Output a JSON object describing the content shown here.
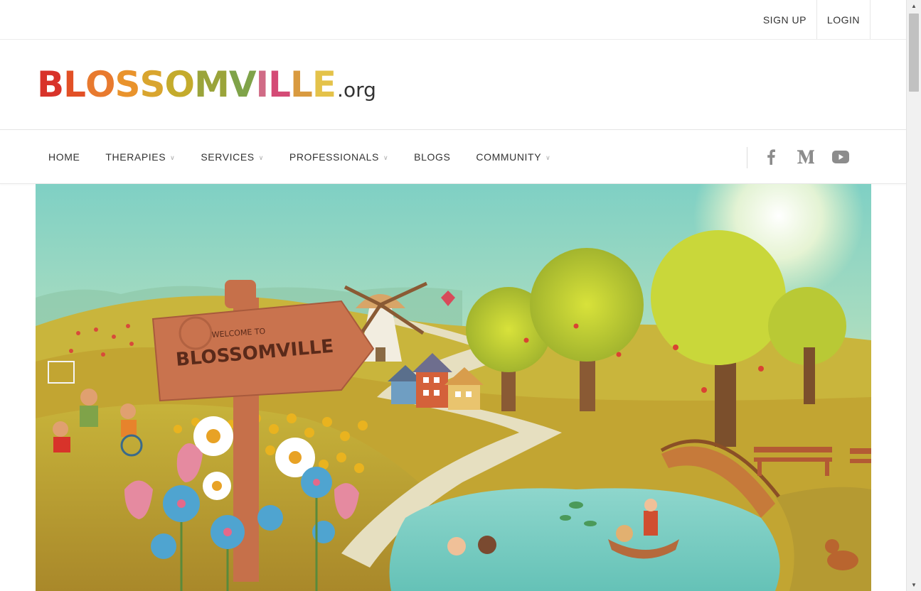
{
  "top_links": {
    "signup": "SIGN UP",
    "login": "LOGIN"
  },
  "logo": {
    "letters": [
      "B",
      "L",
      "O",
      "S",
      "S",
      "O",
      "M",
      "V",
      "I",
      "L",
      "L",
      "E"
    ],
    "colors": [
      "#d8332a",
      "#e25026",
      "#e87a2f",
      "#e9932c",
      "#d9a52e",
      "#c4ab2c",
      "#9aa43a",
      "#7fa349",
      "#d06b86",
      "#d44b76",
      "#d99a3f",
      "#e4c24a"
    ],
    "suffix": ".org"
  },
  "nav": {
    "items": [
      {
        "label": "HOME",
        "dropdown": false
      },
      {
        "label": "THERAPIES",
        "dropdown": true
      },
      {
        "label": "SERVICES",
        "dropdown": true
      },
      {
        "label": "PROFESSIONALS",
        "dropdown": true
      },
      {
        "label": "BLOGS",
        "dropdown": false
      },
      {
        "label": "COMMUNITY",
        "dropdown": true
      }
    ],
    "social": [
      "facebook-icon",
      "medium-icon",
      "youtube-icon"
    ]
  },
  "hero": {
    "sign_line1": "WELCOME TO",
    "sign_line2": "BLOSSOMVILLE"
  }
}
